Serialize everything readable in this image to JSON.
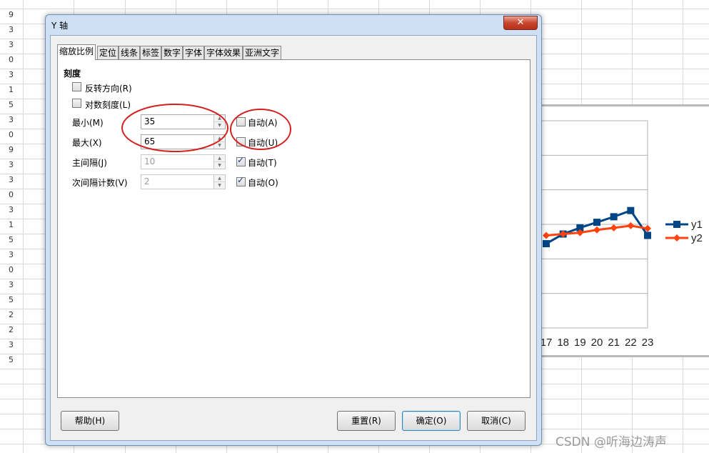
{
  "sheet": {
    "row_numbers": [
      "9",
      "3",
      "3",
      "0",
      "3",
      "1",
      "5",
      "3",
      "0",
      "9",
      "3",
      "3",
      "0",
      "3",
      "1",
      "5",
      "3",
      "0",
      "3",
      "5",
      "2",
      "2",
      "3",
      "5"
    ]
  },
  "chart": {
    "x_tick_labels": [
      "17",
      "18",
      "19",
      "20",
      "21",
      "22",
      "23"
    ],
    "legend": [
      {
        "name": "y1",
        "color": "#004586"
      },
      {
        "name": "y2",
        "color": "#ff420e"
      }
    ]
  },
  "chart_data": {
    "type": "line",
    "x": [
      17,
      18,
      19,
      20,
      21,
      22,
      23
    ],
    "series": [
      {
        "name": "y1",
        "values": [
          47.2,
          48.6,
          49.5,
          50.3,
          51.1,
          52.0,
          48.4
        ],
        "color": "#004586",
        "marker": "square"
      },
      {
        "name": "y2",
        "values": [
          48.4,
          48.6,
          48.8,
          49.2,
          49.5,
          49.8,
          49.4
        ],
        "color": "#ff420e",
        "marker": "diamond"
      }
    ],
    "ylim": [
      35,
      65
    ],
    "grid": true,
    "legend_position": "right"
  },
  "dialog": {
    "title": "Y 轴",
    "close_glyph": "✕",
    "tabs": [
      "缩放比例",
      "定位",
      "线条",
      "标签",
      "数字",
      "字体",
      "字体效果",
      "亚洲文字"
    ],
    "active_tab": 0,
    "section_title": "刻度",
    "reverse_direction": {
      "label": "反转方向(R)",
      "checked": false
    },
    "log_scale": {
      "label": "对数刻度(L)",
      "checked": false
    },
    "fields": [
      {
        "label": "最小(M)",
        "value": "35",
        "enabled": true,
        "auto_label": "自动(A)",
        "auto_checked": false
      },
      {
        "label": "最大(X)",
        "value": "65",
        "enabled": true,
        "auto_label": "自动(U)",
        "auto_checked": false
      },
      {
        "label": "主间隔(J)",
        "value": "10",
        "enabled": false,
        "auto_label": "自动(T)",
        "auto_checked": true
      },
      {
        "label": "次间隔计数(V)",
        "value": "2",
        "enabled": false,
        "auto_label": "自动(O)",
        "auto_checked": true
      }
    ],
    "buttons": {
      "help": "帮助(H)",
      "reset": "重置(R)",
      "ok": "确定(O)",
      "cancel": "取消(C)"
    }
  },
  "watermark": "CSDN @听海边涛声"
}
